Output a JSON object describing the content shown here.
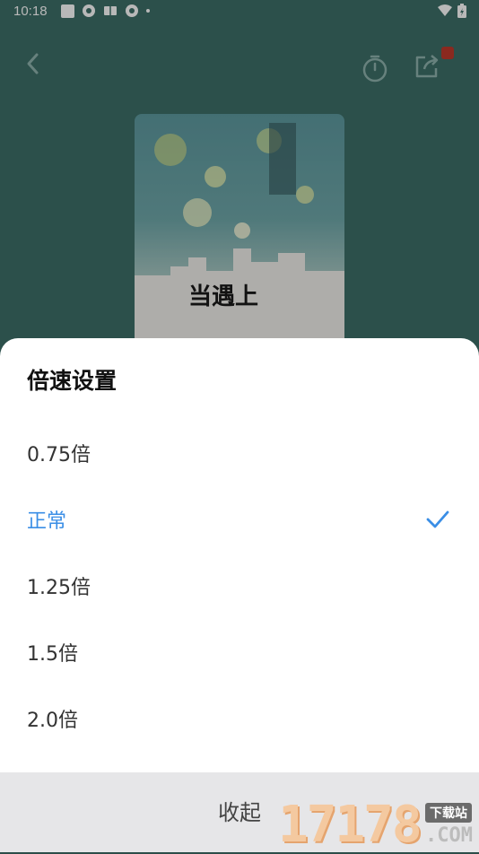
{
  "status_bar": {
    "time": "10:18"
  },
  "cover": {
    "title": "当遇上"
  },
  "speed_sheet": {
    "title": "倍速设置",
    "options": [
      {
        "label": "0.75倍",
        "selected": false
      },
      {
        "label": "正常",
        "selected": true
      },
      {
        "label": "1.25倍",
        "selected": false
      },
      {
        "label": "1.5倍",
        "selected": false
      },
      {
        "label": "2.0倍",
        "selected": false
      }
    ],
    "collapse_label": "收起",
    "accent_color": "#3a8ee6"
  },
  "watermark": {
    "digits": "17178",
    "tag": "下载站",
    "domain": ".COM"
  }
}
